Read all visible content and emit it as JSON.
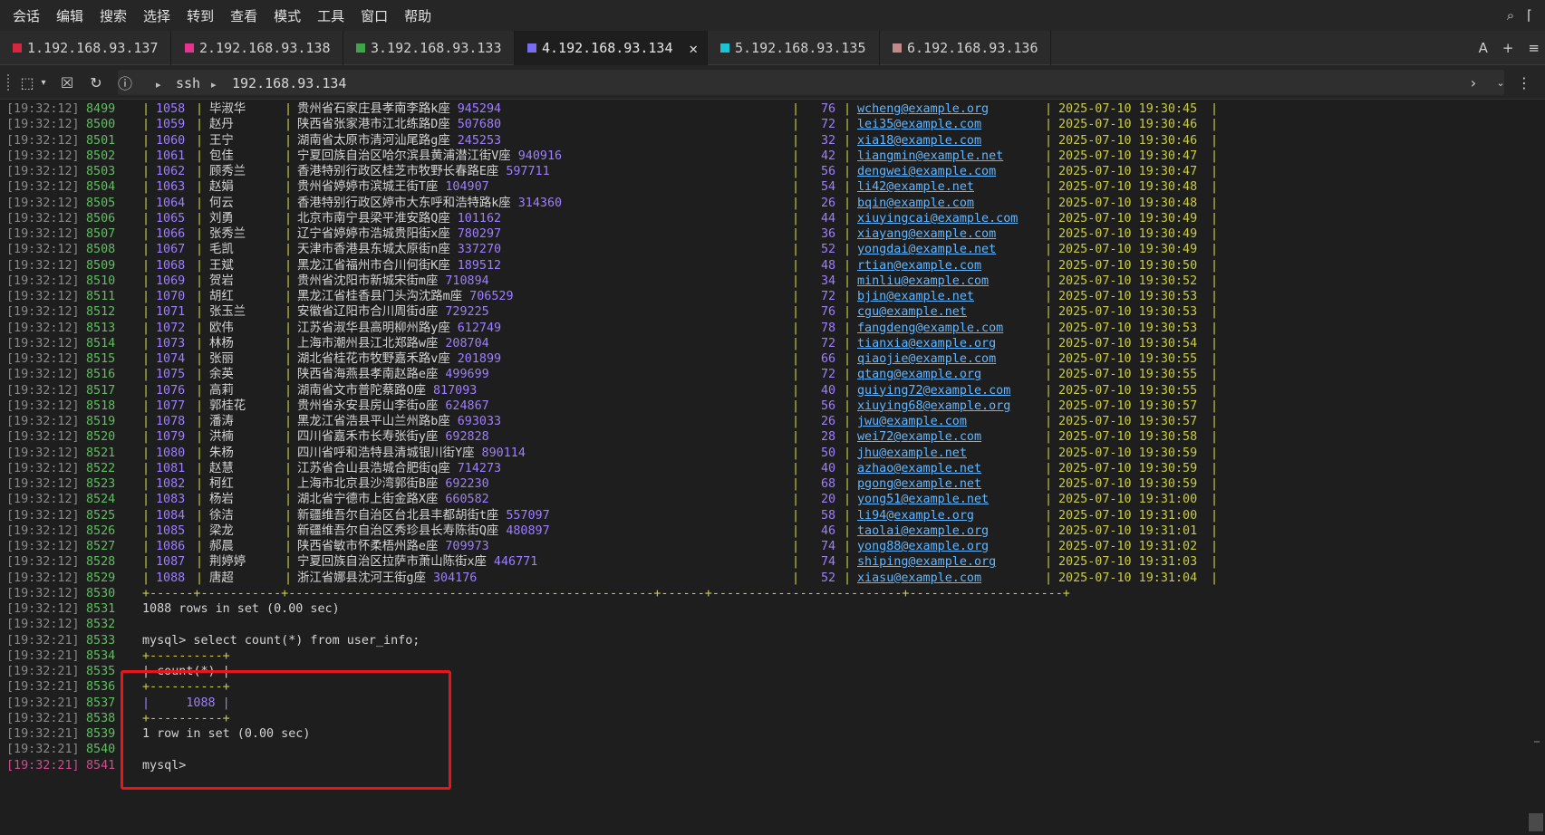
{
  "menu": [
    "会话",
    "编辑",
    "搜索",
    "选择",
    "转到",
    "查看",
    "模式",
    "工具",
    "窗口",
    "帮助"
  ],
  "tabs": [
    {
      "label": "1.192.168.93.137",
      "color": "#d7263d"
    },
    {
      "label": "2.192.168.93.138",
      "color": "#e5338e"
    },
    {
      "label": "3.192.168.93.133",
      "color": "#3fa548"
    },
    {
      "label": "4.192.168.93.134",
      "color": "#7a6cf0",
      "active": true
    },
    {
      "label": "5.192.168.93.135",
      "color": "#19c5d2"
    },
    {
      "label": "6.192.168.93.136",
      "color": "#c28a8a"
    }
  ],
  "tab_close": "✕",
  "tab_right": {
    "a": "A",
    "plus": "+",
    "menu": "≡"
  },
  "toolbar": {
    "path1": "ssh",
    "path2": "192.168.93.134"
  },
  "rows": [
    {
      "ts": "[19:32:12]",
      "ln": "8499",
      "id": "1058",
      "name": "毕淑华",
      "addr": "贵州省石家庄县孝南李路k座",
      "zip": "945294",
      "age": "76",
      "email": "wcheng@example.org",
      "date": "2025-07-10 19:30:45"
    },
    {
      "ts": "[19:32:12]",
      "ln": "8500",
      "id": "1059",
      "name": "赵丹",
      "addr": "陕西省张家港市江北练路D座",
      "zip": "507680",
      "age": "72",
      "email": "lei35@example.com",
      "date": "2025-07-10 19:30:46"
    },
    {
      "ts": "[19:32:12]",
      "ln": "8501",
      "id": "1060",
      "name": "王宁",
      "addr": "湖南省太原市清河汕尾路g座",
      "zip": "245253",
      "age": "32",
      "email": "xia18@example.com",
      "date": "2025-07-10 19:30:46"
    },
    {
      "ts": "[19:32:12]",
      "ln": "8502",
      "id": "1061",
      "name": "包佳",
      "addr": "宁夏回族自治区哈尔滨县黄浦潜江街V座",
      "zip": "940916",
      "age": "42",
      "email": "liangmin@example.net",
      "date": "2025-07-10 19:30:47"
    },
    {
      "ts": "[19:32:12]",
      "ln": "8503",
      "id": "1062",
      "name": "顾秀兰",
      "addr": "香港特别行政区桂芝市牧野长春路E座",
      "zip": "597711",
      "age": "56",
      "email": "dengwei@example.com",
      "date": "2025-07-10 19:30:47"
    },
    {
      "ts": "[19:32:12]",
      "ln": "8504",
      "id": "1063",
      "name": "赵娟",
      "addr": "贵州省婷婷市滨城王街T座",
      "zip": "104907",
      "age": "54",
      "email": "li42@example.net",
      "date": "2025-07-10 19:30:48"
    },
    {
      "ts": "[19:32:12]",
      "ln": "8505",
      "id": "1064",
      "name": "何云",
      "addr": "香港特别行政区婷市大东呼和浩特路k座",
      "zip": "314360",
      "age": "26",
      "email": "bqin@example.com",
      "date": "2025-07-10 19:30:48"
    },
    {
      "ts": "[19:32:12]",
      "ln": "8506",
      "id": "1065",
      "name": "刘勇",
      "addr": "北京市南宁县梁平淮安路Q座",
      "zip": "101162",
      "age": "44",
      "email": "xiuyingcai@example.com",
      "date": "2025-07-10 19:30:49"
    },
    {
      "ts": "[19:32:12]",
      "ln": "8507",
      "id": "1066",
      "name": "张秀兰",
      "addr": "辽宁省婷婷市浩城贵阳街x座",
      "zip": "780297",
      "age": "36",
      "email": "xiayang@example.com",
      "date": "2025-07-10 19:30:49"
    },
    {
      "ts": "[19:32:12]",
      "ln": "8508",
      "id": "1067",
      "name": "毛凯",
      "addr": "天津市香港县东城太原街n座",
      "zip": "337270",
      "age": "52",
      "email": "yongdai@example.net",
      "date": "2025-07-10 19:30:49"
    },
    {
      "ts": "[19:32:12]",
      "ln": "8509",
      "id": "1068",
      "name": "王斌",
      "addr": "黑龙江省福州市合川何街K座",
      "zip": "189512",
      "age": "48",
      "email": "rtian@example.com",
      "date": "2025-07-10 19:30:50"
    },
    {
      "ts": "[19:32:12]",
      "ln": "8510",
      "id": "1069",
      "name": "贺岩",
      "addr": "贵州省沈阳市新城宋街m座",
      "zip": "710894",
      "age": "34",
      "email": "minliu@example.com",
      "date": "2025-07-10 19:30:52"
    },
    {
      "ts": "[19:32:12]",
      "ln": "8511",
      "id": "1070",
      "name": "胡红",
      "addr": "黑龙江省桂香县门头沟沈路m座",
      "zip": "706529",
      "age": "72",
      "email": "bjin@example.net",
      "date": "2025-07-10 19:30:53"
    },
    {
      "ts": "[19:32:12]",
      "ln": "8512",
      "id": "1071",
      "name": "张玉兰",
      "addr": "安徽省辽阳市合川周街d座",
      "zip": "729225",
      "age": "76",
      "email": "cgu@example.net",
      "date": "2025-07-10 19:30:53"
    },
    {
      "ts": "[19:32:12]",
      "ln": "8513",
      "id": "1072",
      "name": "欧伟",
      "addr": "江苏省淑华县高明柳州路y座",
      "zip": "612749",
      "age": "78",
      "email": "fangdeng@example.com",
      "date": "2025-07-10 19:30:53"
    },
    {
      "ts": "[19:32:12]",
      "ln": "8514",
      "id": "1073",
      "name": "林杨",
      "addr": "上海市潮州县江北郑路w座",
      "zip": "208704",
      "age": "72",
      "email": "tianxia@example.org",
      "date": "2025-07-10 19:30:54"
    },
    {
      "ts": "[19:32:12]",
      "ln": "8515",
      "id": "1074",
      "name": "张丽",
      "addr": "湖北省桂花市牧野嘉禾路v座",
      "zip": "201899",
      "age": "66",
      "email": "qiaojie@example.com",
      "date": "2025-07-10 19:30:55"
    },
    {
      "ts": "[19:32:12]",
      "ln": "8516",
      "id": "1075",
      "name": "余英",
      "addr": "陕西省海燕县孝南赵路e座",
      "zip": "499699",
      "age": "72",
      "email": "qtang@example.org",
      "date": "2025-07-10 19:30:55"
    },
    {
      "ts": "[19:32:12]",
      "ln": "8517",
      "id": "1076",
      "name": "高莉",
      "addr": "湖南省文市普陀蔡路O座",
      "zip": "817093",
      "age": "40",
      "email": "guiying72@example.com",
      "date": "2025-07-10 19:30:55"
    },
    {
      "ts": "[19:32:12]",
      "ln": "8518",
      "id": "1077",
      "name": "郭桂花",
      "addr": "贵州省永安县房山李街o座",
      "zip": "624867",
      "age": "56",
      "email": "xiuying68@example.org",
      "date": "2025-07-10 19:30:57"
    },
    {
      "ts": "[19:32:12]",
      "ln": "8519",
      "id": "1078",
      "name": "潘涛",
      "addr": "黑龙江省浩县平山兰州路b座",
      "zip": "693033",
      "age": "26",
      "email": "jwu@example.com",
      "date": "2025-07-10 19:30:57"
    },
    {
      "ts": "[19:32:12]",
      "ln": "8520",
      "id": "1079",
      "name": "洪楠",
      "addr": "四川省嘉禾市长寿张街y座",
      "zip": "692828",
      "age": "28",
      "email": "wei72@example.com",
      "date": "2025-07-10 19:30:58"
    },
    {
      "ts": "[19:32:12]",
      "ln": "8521",
      "id": "1080",
      "name": "朱杨",
      "addr": "四川省呼和浩特县清城银川街Y座",
      "zip": "890114",
      "age": "50",
      "email": "jhu@example.net",
      "date": "2025-07-10 19:30:59"
    },
    {
      "ts": "[19:32:12]",
      "ln": "8522",
      "id": "1081",
      "name": "赵慧",
      "addr": "江苏省合山县浩城合肥街q座",
      "zip": "714273",
      "age": "40",
      "email": "azhao@example.net",
      "date": "2025-07-10 19:30:59"
    },
    {
      "ts": "[19:32:12]",
      "ln": "8523",
      "id": "1082",
      "name": "柯红",
      "addr": "上海市北京县沙湾郭街B座",
      "zip": "692230",
      "age": "68",
      "email": "pgong@example.net",
      "date": "2025-07-10 19:30:59"
    },
    {
      "ts": "[19:32:12]",
      "ln": "8524",
      "id": "1083",
      "name": "杨岩",
      "addr": "湖北省宁德市上街金路X座",
      "zip": "660582",
      "age": "20",
      "email": "yong51@example.net",
      "date": "2025-07-10 19:31:00"
    },
    {
      "ts": "[19:32:12]",
      "ln": "8525",
      "id": "1084",
      "name": "徐洁",
      "addr": "新疆维吾尔自治区台北县丰都胡街t座",
      "zip": "557097",
      "age": "58",
      "email": "li94@example.org",
      "date": "2025-07-10 19:31:00"
    },
    {
      "ts": "[19:32:12]",
      "ln": "8526",
      "id": "1085",
      "name": "梁龙",
      "addr": "新疆维吾尔自治区秀珍县长寿陈街Q座",
      "zip": "480897",
      "age": "46",
      "email": "taolai@example.org",
      "date": "2025-07-10 19:31:01"
    },
    {
      "ts": "[19:32:12]",
      "ln": "8527",
      "id": "1086",
      "name": "郝晨",
      "addr": "陕西省敏市怀柔梧州路e座",
      "zip": "709973",
      "age": "74",
      "email": "yong88@example.org",
      "date": "2025-07-10 19:31:02"
    },
    {
      "ts": "[19:32:12]",
      "ln": "8528",
      "id": "1087",
      "name": "荆婷婷",
      "addr": "宁夏回族自治区拉萨市萧山陈街x座",
      "zip": "446771",
      "age": "74",
      "email": "shiping@example.org",
      "date": "2025-07-10 19:31:03"
    },
    {
      "ts": "[19:32:12]",
      "ln": "8529",
      "id": "1088",
      "name": "唐超",
      "addr": "浙江省娜县沈河王街g座",
      "zip": "304176",
      "age": "52",
      "email": "xiasu@example.com",
      "date": "2025-07-10 19:31:04"
    }
  ],
  "table_border": "+------+-----------+--------------------------------------------------+------+--------------------------+---------------------+",
  "tail_lines": [
    {
      "ts": "[19:32:12]",
      "ln": "8530",
      "text": "",
      "kind": "border"
    },
    {
      "ts": "[19:32:12]",
      "ln": "8531",
      "text": "1088 rows in set (0.00 sec)",
      "kind": "text"
    },
    {
      "ts": "[19:32:12]",
      "ln": "8532",
      "text": "",
      "kind": "text"
    },
    {
      "ts": "[19:32:21]",
      "ln": "8533",
      "text": "mysql> select count(*) from user_info;",
      "kind": "text"
    },
    {
      "ts": "[19:32:21]",
      "ln": "8534",
      "text": "+----------+",
      "kind": "yellow"
    },
    {
      "ts": "[19:32:21]",
      "ln": "8535",
      "text": "| count(*) |",
      "kind": "count-header"
    },
    {
      "ts": "[19:32:21]",
      "ln": "8536",
      "text": "+----------+",
      "kind": "yellow"
    },
    {
      "ts": "[19:32:21]",
      "ln": "8537",
      "text": "|     1088 |",
      "kind": "count-value"
    },
    {
      "ts": "[19:32:21]",
      "ln": "8538",
      "text": "+----------+",
      "kind": "yellow"
    },
    {
      "ts": "[19:32:21]",
      "ln": "8539",
      "text": "1 row in set (0.00 sec)",
      "kind": "text"
    },
    {
      "ts": "[19:32:21]",
      "ln": "8540",
      "text": "",
      "kind": "text"
    },
    {
      "ts": "[19:32:21]",
      "ln": "8541",
      "text": "mysql>",
      "kind": "text",
      "red": true
    }
  ]
}
